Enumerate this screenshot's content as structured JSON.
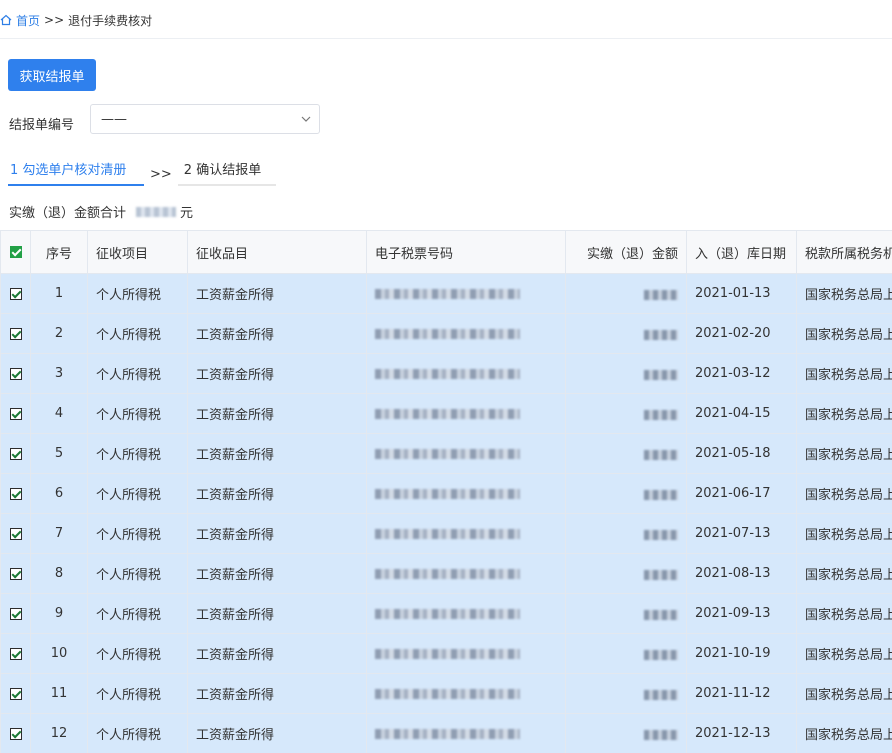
{
  "breadcrumb": {
    "home": "首页",
    "separator": ">>",
    "current": "退付手续费核对"
  },
  "toolbar": {
    "fetch_label": "获取结报单"
  },
  "report": {
    "label": "结报单编号",
    "selected_value": "——"
  },
  "steps": [
    {
      "label": "1 勾选单户核对清册",
      "active": true
    },
    {
      "label": "2 确认结报单",
      "active": false
    }
  ],
  "steps_separator": ">>",
  "total": {
    "label": "实缴（退）金额合计",
    "unit": "元"
  },
  "table": {
    "columns": [
      "序号",
      "征收项目",
      "征收品目",
      "电子税票号码",
      "实缴（退）金额",
      "入（退）库日期",
      "税款所属税务机关"
    ],
    "rows": [
      {
        "no": "1",
        "item": "个人所得税",
        "category": "工资薪金所得",
        "date": "2021-01-13",
        "authority": "国家税务总局上"
      },
      {
        "no": "2",
        "item": "个人所得税",
        "category": "工资薪金所得",
        "date": "2021-02-20",
        "authority": "国家税务总局上"
      },
      {
        "no": "3",
        "item": "个人所得税",
        "category": "工资薪金所得",
        "date": "2021-03-12",
        "authority": "国家税务总局上"
      },
      {
        "no": "4",
        "item": "个人所得税",
        "category": "工资薪金所得",
        "date": "2021-04-15",
        "authority": "国家税务总局上"
      },
      {
        "no": "5",
        "item": "个人所得税",
        "category": "工资薪金所得",
        "date": "2021-05-18",
        "authority": "国家税务总局上"
      },
      {
        "no": "6",
        "item": "个人所得税",
        "category": "工资薪金所得",
        "date": "2021-06-17",
        "authority": "国家税务总局上"
      },
      {
        "no": "7",
        "item": "个人所得税",
        "category": "工资薪金所得",
        "date": "2021-07-13",
        "authority": "国家税务总局上"
      },
      {
        "no": "8",
        "item": "个人所得税",
        "category": "工资薪金所得",
        "date": "2021-08-13",
        "authority": "国家税务总局上"
      },
      {
        "no": "9",
        "item": "个人所得税",
        "category": "工资薪金所得",
        "date": "2021-09-13",
        "authority": "国家税务总局上"
      },
      {
        "no": "10",
        "item": "个人所得税",
        "category": "工资薪金所得",
        "date": "2021-10-19",
        "authority": "国家税务总局上"
      },
      {
        "no": "11",
        "item": "个人所得税",
        "category": "工资薪金所得",
        "date": "2021-11-12",
        "authority": "国家税务总局上"
      },
      {
        "no": "12",
        "item": "个人所得税",
        "category": "工资薪金所得",
        "date": "2021-12-13",
        "authority": "国家税务总局上"
      }
    ]
  },
  "icons": {
    "home": "home-icon",
    "dropdown": "chevron-down-icon",
    "checkbox": "checkbox-checked-icon"
  },
  "colors": {
    "primary": "#2f80ed",
    "row_selected": "#d6e8fb",
    "header_bg": "#f7f8fa",
    "check_green": "#22a046"
  }
}
